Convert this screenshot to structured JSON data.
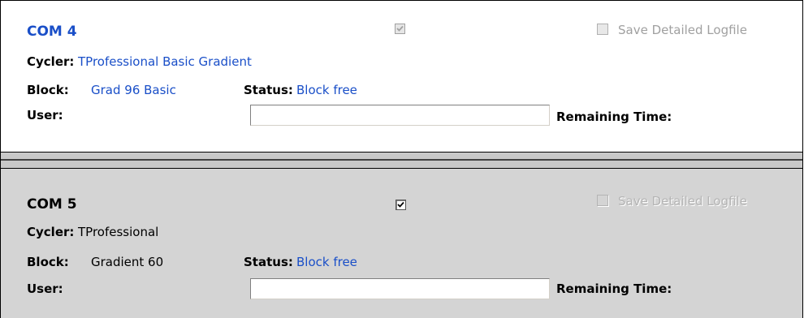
{
  "com4": {
    "title": "COM 4",
    "cycler_label": "Cycler:",
    "cycler_value": "TProfessional Basic Gradient",
    "block_label": "Block:",
    "block_value": "Grad 96 Basic",
    "status_label": "Status:",
    "status_value": "Block free",
    "user_label": "User:",
    "user_value": "",
    "remaining_label": "Remaining Time:",
    "active_checked": true,
    "active_enabled": false,
    "save_log_label": "Save Detailed Logfile",
    "save_log_checked": false
  },
  "com5": {
    "title": "COM 5",
    "cycler_label": "Cycler:",
    "cycler_value": "TProfessional",
    "block_label": "Block:",
    "block_value": "Gradient 60",
    "status_label": "Status:",
    "status_value": "Block free",
    "user_label": "User:",
    "user_value": "",
    "remaining_label": "Remaining Time:",
    "active_checked": true,
    "active_enabled": true,
    "save_log_label": "Save Detailed Logfile",
    "save_log_checked": false
  },
  "colors": {
    "accent": "#1a4fc8",
    "panel_active_bg": "#d4d4d4"
  }
}
